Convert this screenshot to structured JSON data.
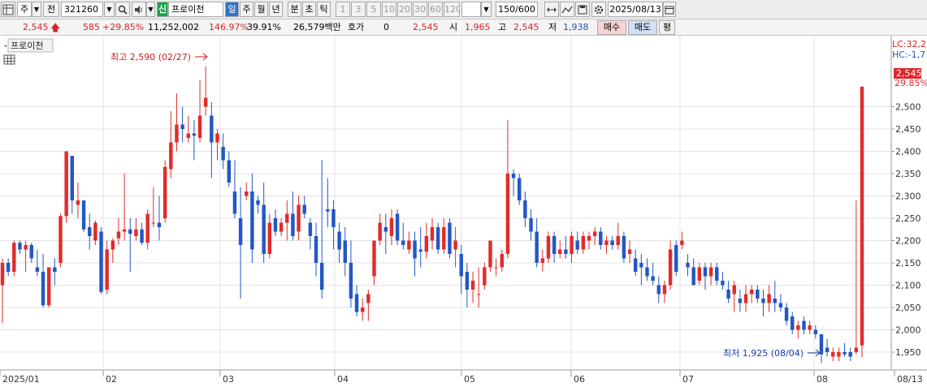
{
  "toolbar": {
    "field1": "주",
    "field2": "전",
    "code": "321260",
    "badge": "신",
    "name": "프로이천",
    "periods": [
      "일",
      "주",
      "월",
      "년",
      "분",
      "초",
      "틱"
    ],
    "intervals": [
      "1",
      "3",
      "5",
      "10",
      "20",
      "30",
      "60",
      "120"
    ],
    "count": "150/600",
    "date": "2025/08/13"
  },
  "quote": {
    "price": "2,545",
    "change": "585",
    "change_pct": "+29.85%",
    "volume": "11,252,002",
    "vol_ratio": "146.97%",
    "turnover": "39.91%",
    "amount": "26,579백만",
    "hoga_label": "호가",
    "hoga_value": "0",
    "hoga_price": "2,545",
    "open_label": "시",
    "open": "1,965",
    "high_label": "고",
    "high": "2,545",
    "low_label": "저",
    "low": "1,938",
    "buy_label": "매수",
    "sell_label": "매도",
    "flat_label": "평"
  },
  "chart_header": {
    "title": "프로이천",
    "lc_label": "LC:32,2",
    "hc_label": "HC:-1,7"
  },
  "chart_data": {
    "type": "candlestick",
    "y_ticks": [
      "1,950",
      "2,000",
      "2,050",
      "2,100",
      "2,150",
      "2,200",
      "2,250",
      "2,300",
      "2,350",
      "2,400",
      "2,450",
      "2,500"
    ],
    "x_ticks": [
      "2025/01",
      "02",
      "03",
      "04",
      "05",
      "06",
      "07",
      "08",
      "08/13"
    ],
    "ylim": [
      1910,
      2650
    ],
    "last_price": "2,545",
    "last_pct": "29.85%",
    "max_label": "최고 2,590 (02/27)",
    "min_label": "최저 1,925 (08/04)",
    "colors": {
      "up": "#e22b2b",
      "down": "#2357c6"
    },
    "candles": [
      {
        "o": 2100,
        "h": 2160,
        "l": 2015,
        "c": 2150
      },
      {
        "o": 2150,
        "h": 2160,
        "l": 2120,
        "c": 2130
      },
      {
        "o": 2130,
        "h": 2200,
        "l": 2120,
        "c": 2195
      },
      {
        "o": 2195,
        "h": 2200,
        "l": 2170,
        "c": 2180
      },
      {
        "o": 2180,
        "h": 2200,
        "l": 2130,
        "c": 2190
      },
      {
        "o": 2190,
        "h": 2195,
        "l": 2150,
        "c": 2160
      },
      {
        "o": 2140,
        "h": 2180,
        "l": 2120,
        "c": 2130
      },
      {
        "o": 2130,
        "h": 2170,
        "l": 2050,
        "c": 2055
      },
      {
        "o": 2055,
        "h": 2140,
        "l": 2050,
        "c": 2140
      },
      {
        "o": 2140,
        "h": 2160,
        "l": 2100,
        "c": 2130
      },
      {
        "o": 2150,
        "h": 2260,
        "l": 2140,
        "c": 2255
      },
      {
        "o": 2255,
        "h": 2400,
        "l": 2240,
        "c": 2400
      },
      {
        "o": 2390,
        "h": 2390,
        "l": 2260,
        "c": 2290
      },
      {
        "o": 2280,
        "h": 2330,
        "l": 2250,
        "c": 2290
      },
      {
        "o": 2290,
        "h": 2290,
        "l": 2220,
        "c": 2225
      },
      {
        "o": 2230,
        "h": 2260,
        "l": 2180,
        "c": 2210
      },
      {
        "o": 2200,
        "h": 2245,
        "l": 2190,
        "c": 2240
      },
      {
        "o": 2220,
        "h": 2230,
        "l": 2080,
        "c": 2085
      },
      {
        "o": 2090,
        "h": 2200,
        "l": 2080,
        "c": 2180
      },
      {
        "o": 2180,
        "h": 2205,
        "l": 2150,
        "c": 2200
      },
      {
        "o": 2205,
        "h": 2250,
        "l": 2190,
        "c": 2220
      },
      {
        "o": 2220,
        "h": 2350,
        "l": 2200,
        "c": 2225
      },
      {
        "o": 2225,
        "h": 2250,
        "l": 2130,
        "c": 2215
      },
      {
        "o": 2210,
        "h": 2250,
        "l": 2200,
        "c": 2225
      },
      {
        "o": 2225,
        "h": 2240,
        "l": 2190,
        "c": 2195
      },
      {
        "o": 2195,
        "h": 2270,
        "l": 2180,
        "c": 2260
      },
      {
        "o": 2240,
        "h": 2320,
        "l": 2230,
        "c": 2240
      },
      {
        "o": 2240,
        "h": 2300,
        "l": 2200,
        "c": 2230
      },
      {
        "o": 2250,
        "h": 2380,
        "l": 2240,
        "c": 2365
      },
      {
        "o": 2360,
        "h": 2490,
        "l": 2340,
        "c": 2420
      },
      {
        "o": 2420,
        "h": 2530,
        "l": 2400,
        "c": 2460
      },
      {
        "o": 2460,
        "h": 2500,
        "l": 2420,
        "c": 2450
      },
      {
        "o": 2430,
        "h": 2480,
        "l": 2420,
        "c": 2440
      },
      {
        "o": 2440,
        "h": 2470,
        "l": 2380,
        "c": 2435
      },
      {
        "o": 2430,
        "h": 2560,
        "l": 2420,
        "c": 2480
      },
      {
        "o": 2500,
        "h": 2590,
        "l": 2480,
        "c": 2520
      },
      {
        "o": 2480,
        "h": 2510,
        "l": 2340,
        "c": 2420
      },
      {
        "o": 2420,
        "h": 2450,
        "l": 2380,
        "c": 2440
      },
      {
        "o": 2410,
        "h": 2440,
        "l": 2360,
        "c": 2380
      },
      {
        "o": 2380,
        "h": 2400,
        "l": 2320,
        "c": 2330
      },
      {
        "o": 2310,
        "h": 2380,
        "l": 2250,
        "c": 2260
      },
      {
        "o": 2250,
        "h": 2320,
        "l": 2070,
        "c": 2190
      },
      {
        "o": 2300,
        "h": 2330,
        "l": 2290,
        "c": 2310
      },
      {
        "o": 2310,
        "h": 2350,
        "l": 2150,
        "c": 2180
      },
      {
        "o": 2290,
        "h": 2300,
        "l": 2260,
        "c": 2280
      },
      {
        "o": 2280,
        "h": 2330,
        "l": 2150,
        "c": 2170
      },
      {
        "o": 2170,
        "h": 2260,
        "l": 2160,
        "c": 2240
      },
      {
        "o": 2250,
        "h": 2270,
        "l": 2210,
        "c": 2220
      },
      {
        "o": 2220,
        "h": 2250,
        "l": 2210,
        "c": 2240
      },
      {
        "o": 2240,
        "h": 2290,
        "l": 2200,
        "c": 2260
      },
      {
        "o": 2260,
        "h": 2310,
        "l": 2200,
        "c": 2210
      },
      {
        "o": 2220,
        "h": 2300,
        "l": 2200,
        "c": 2280
      },
      {
        "o": 2280,
        "h": 2300,
        "l": 2250,
        "c": 2260
      },
      {
        "o": 2240,
        "h": 2250,
        "l": 2180,
        "c": 2210
      },
      {
        "o": 2210,
        "h": 2240,
        "l": 2120,
        "c": 2150
      },
      {
        "o": 2150,
        "h": 2380,
        "l": 2070,
        "c": 2090
      },
      {
        "o": 2270,
        "h": 2340,
        "l": 2230,
        "c": 2265
      },
      {
        "o": 2270,
        "h": 2290,
        "l": 2180,
        "c": 2230
      },
      {
        "o": 2220,
        "h": 2240,
        "l": 2150,
        "c": 2180
      },
      {
        "o": 2200,
        "h": 2230,
        "l": 2120,
        "c": 2150
      },
      {
        "o": 2150,
        "h": 2200,
        "l": 2050,
        "c": 2070
      },
      {
        "o": 2080,
        "h": 2100,
        "l": 2030,
        "c": 2040
      },
      {
        "o": 2040,
        "h": 2070,
        "l": 2020,
        "c": 2050
      },
      {
        "o": 2060,
        "h": 2090,
        "l": 2020,
        "c": 2080
      },
      {
        "o": 2120,
        "h": 2200,
        "l": 2100,
        "c": 2200
      },
      {
        "o": 2200,
        "h": 2260,
        "l": 2190,
        "c": 2240
      },
      {
        "o": 2230,
        "h": 2260,
        "l": 2170,
        "c": 2220
      },
      {
        "o": 2210,
        "h": 2270,
        "l": 2190,
        "c": 2250
      },
      {
        "o": 2260,
        "h": 2270,
        "l": 2190,
        "c": 2200
      },
      {
        "o": 2200,
        "h": 2240,
        "l": 2180,
        "c": 2190
      },
      {
        "o": 2180,
        "h": 2220,
        "l": 2170,
        "c": 2200
      },
      {
        "o": 2200,
        "h": 2220,
        "l": 2120,
        "c": 2160
      },
      {
        "o": 2180,
        "h": 2230,
        "l": 2140,
        "c": 2175
      },
      {
        "o": 2175,
        "h": 2240,
        "l": 2160,
        "c": 2210
      },
      {
        "o": 2200,
        "h": 2250,
        "l": 2180,
        "c": 2230
      },
      {
        "o": 2230,
        "h": 2240,
        "l": 2170,
        "c": 2180
      },
      {
        "o": 2180,
        "h": 2250,
        "l": 2170,
        "c": 2230
      },
      {
        "o": 2240,
        "h": 2250,
        "l": 2160,
        "c": 2170
      },
      {
        "o": 2180,
        "h": 2230,
        "l": 2140,
        "c": 2200
      },
      {
        "o": 2170,
        "h": 2190,
        "l": 2080,
        "c": 2120
      },
      {
        "o": 2130,
        "h": 2150,
        "l": 2050,
        "c": 2090
      },
      {
        "o": 2090,
        "h": 2130,
        "l": 2060,
        "c": 2110
      },
      {
        "o": 2080,
        "h": 2140,
        "l": 2050,
        "c": 2080
      },
      {
        "o": 2100,
        "h": 2150,
        "l": 2090,
        "c": 2140
      },
      {
        "o": 2140,
        "h": 2200,
        "l": 2130,
        "c": 2200
      },
      {
        "o": 2140,
        "h": 2160,
        "l": 2120,
        "c": 2140
      },
      {
        "o": 2140,
        "h": 2180,
        "l": 2130,
        "c": 2170
      },
      {
        "o": 2170,
        "h": 2470,
        "l": 2160,
        "c": 2350
      },
      {
        "o": 2350,
        "h": 2360,
        "l": 2300,
        "c": 2340
      },
      {
        "o": 2340,
        "h": 2350,
        "l": 2280,
        "c": 2290
      },
      {
        "o": 2290,
        "h": 2310,
        "l": 2230,
        "c": 2250
      },
      {
        "o": 2250,
        "h": 2270,
        "l": 2200,
        "c": 2220
      },
      {
        "o": 2220,
        "h": 2250,
        "l": 2140,
        "c": 2150
      },
      {
        "o": 2150,
        "h": 2180,
        "l": 2130,
        "c": 2160
      },
      {
        "o": 2160,
        "h": 2220,
        "l": 2150,
        "c": 2210
      },
      {
        "o": 2210,
        "h": 2220,
        "l": 2150,
        "c": 2170
      },
      {
        "o": 2170,
        "h": 2200,
        "l": 2160,
        "c": 2180
      },
      {
        "o": 2180,
        "h": 2210,
        "l": 2160,
        "c": 2170
      },
      {
        "o": 2170,
        "h": 2220,
        "l": 2150,
        "c": 2210
      },
      {
        "o": 2200,
        "h": 2220,
        "l": 2170,
        "c": 2180
      },
      {
        "o": 2180,
        "h": 2220,
        "l": 2170,
        "c": 2210
      },
      {
        "o": 2200,
        "h": 2220,
        "l": 2180,
        "c": 2210
      },
      {
        "o": 2210,
        "h": 2230,
        "l": 2190,
        "c": 2220
      },
      {
        "o": 2220,
        "h": 2230,
        "l": 2180,
        "c": 2190
      },
      {
        "o": 2190,
        "h": 2210,
        "l": 2170,
        "c": 2200
      },
      {
        "o": 2200,
        "h": 2210,
        "l": 2180,
        "c": 2190
      },
      {
        "o": 2190,
        "h": 2240,
        "l": 2180,
        "c": 2210
      },
      {
        "o": 2210,
        "h": 2220,
        "l": 2150,
        "c": 2160
      },
      {
        "o": 2170,
        "h": 2200,
        "l": 2150,
        "c": 2180
      },
      {
        "o": 2160,
        "h": 2180,
        "l": 2120,
        "c": 2130
      },
      {
        "o": 2150,
        "h": 2170,
        "l": 2100,
        "c": 2140
      },
      {
        "o": 2140,
        "h": 2160,
        "l": 2110,
        "c": 2120
      },
      {
        "o": 2120,
        "h": 2150,
        "l": 2100,
        "c": 2110
      },
      {
        "o": 2100,
        "h": 2120,
        "l": 2060,
        "c": 2080
      },
      {
        "o": 2080,
        "h": 2110,
        "l": 2060,
        "c": 2100
      },
      {
        "o": 2100,
        "h": 2200,
        "l": 2090,
        "c": 2180
      },
      {
        "o": 2190,
        "h": 2200,
        "l": 2120,
        "c": 2130
      },
      {
        "o": 2190,
        "h": 2220,
        "l": 2180,
        "c": 2200
      },
      {
        "o": 2150,
        "h": 2170,
        "l": 2120,
        "c": 2140
      },
      {
        "o": 2140,
        "h": 2160,
        "l": 2100,
        "c": 2100
      },
      {
        "o": 2110,
        "h": 2150,
        "l": 2100,
        "c": 2140
      },
      {
        "o": 2140,
        "h": 2150,
        "l": 2090,
        "c": 2120
      },
      {
        "o": 2120,
        "h": 2150,
        "l": 2100,
        "c": 2140
      },
      {
        "o": 2140,
        "h": 2150,
        "l": 2100,
        "c": 2110
      },
      {
        "o": 2110,
        "h": 2130,
        "l": 2090,
        "c": 2100
      },
      {
        "o": 2090,
        "h": 2110,
        "l": 2060,
        "c": 2070
      },
      {
        "o": 2080,
        "h": 2110,
        "l": 2040,
        "c": 2100
      },
      {
        "o": 2070,
        "h": 2090,
        "l": 2040,
        "c": 2060
      },
      {
        "o": 2060,
        "h": 2100,
        "l": 2040,
        "c": 2080
      },
      {
        "o": 2080,
        "h": 2100,
        "l": 2060,
        "c": 2090
      },
      {
        "o": 2090,
        "h": 2100,
        "l": 2060,
        "c": 2070
      },
      {
        "o": 2070,
        "h": 2090,
        "l": 2030,
        "c": 2060
      },
      {
        "o": 2060,
        "h": 2100,
        "l": 2040,
        "c": 2080
      },
      {
        "o": 2070,
        "h": 2110,
        "l": 2040,
        "c": 2060
      },
      {
        "o": 2060,
        "h": 2080,
        "l": 2040,
        "c": 2050
      },
      {
        "o": 2050,
        "h": 2060,
        "l": 2010,
        "c": 2020
      },
      {
        "o": 2030,
        "h": 2040,
        "l": 1990,
        "c": 2000
      },
      {
        "o": 2000,
        "h": 2020,
        "l": 1980,
        "c": 2010
      },
      {
        "o": 2020,
        "h": 2030,
        "l": 1990,
        "c": 2000
      },
      {
        "o": 2000,
        "h": 2020,
        "l": 1990,
        "c": 2010
      },
      {
        "o": 2000,
        "h": 2010,
        "l": 1980,
        "c": 1990
      },
      {
        "o": 1990,
        "h": 1990,
        "l": 1925,
        "c": 1945
      },
      {
        "o": 1960,
        "h": 1980,
        "l": 1940,
        "c": 1950
      },
      {
        "o": 1940,
        "h": 1960,
        "l": 1930,
        "c": 1950
      },
      {
        "o": 1940,
        "h": 1960,
        "l": 1930,
        "c": 1950
      },
      {
        "o": 1950,
        "h": 1970,
        "l": 1940,
        "c": 1945
      },
      {
        "o": 1950,
        "h": 1960,
        "l": 1930,
        "c": 1940
      },
      {
        "o": 1950,
        "h": 2290,
        "l": 1945,
        "c": 1960
      },
      {
        "o": 1965,
        "h": 2545,
        "l": 1938,
        "c": 2545
      }
    ]
  }
}
